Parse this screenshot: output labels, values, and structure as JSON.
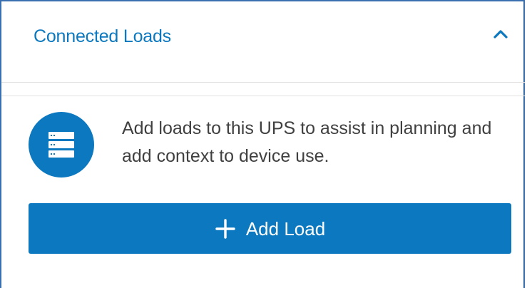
{
  "panel": {
    "title": "Connected Loads",
    "collapse_icon": "chevron-up-icon",
    "accent_color": "#0b78bf"
  },
  "empty_state": {
    "icon": "server-rack-icon",
    "description": "Add loads to this UPS to assist in planning and add context to device use."
  },
  "actions": {
    "add_load_icon": "plus-icon",
    "add_load_label": "Add Load"
  }
}
